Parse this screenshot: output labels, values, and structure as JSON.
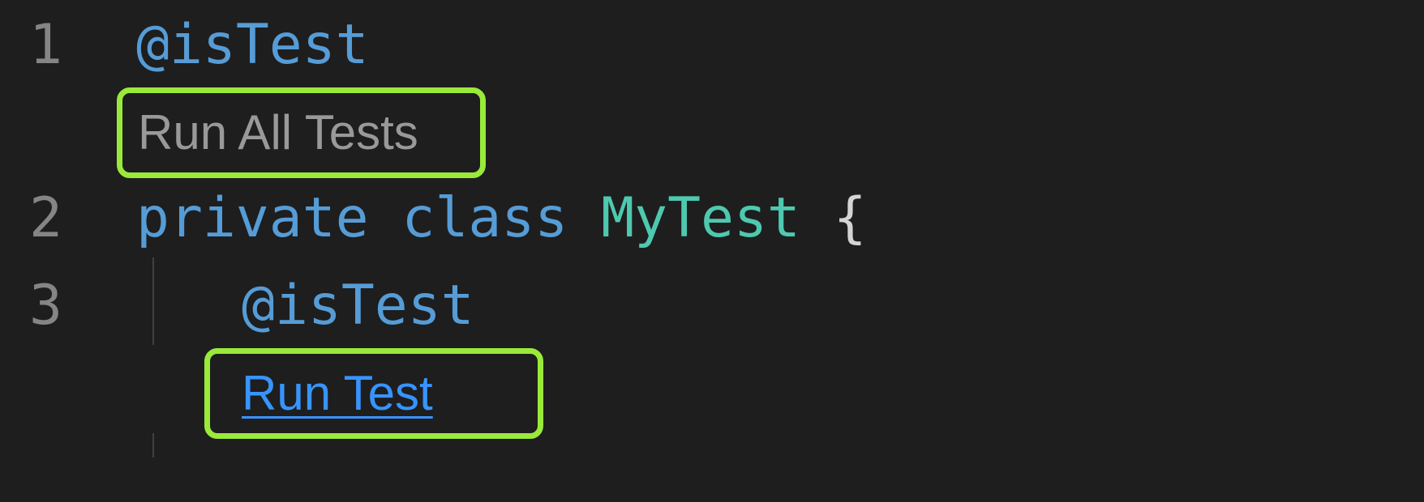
{
  "editor": {
    "lines": [
      {
        "number": "1",
        "annotation": "@isTest"
      },
      {
        "number": "2",
        "kw_private": "private",
        "kw_class": "class",
        "class_name": "MyTest",
        "brace": "{"
      },
      {
        "number": "3",
        "annotation": "@isTest"
      }
    ],
    "codelens": {
      "run_all_tests": "Run All Tests",
      "run_test": "Run Test"
    }
  },
  "colors": {
    "background": "#1e1e1e",
    "keyword": "#569cd6",
    "class_name": "#4ec9b0",
    "punctuation": "#d4d4d4",
    "line_number": "#858585",
    "codelens_muted": "#999999",
    "codelens_link": "#3794ff",
    "highlight": "#9aea3a"
  }
}
